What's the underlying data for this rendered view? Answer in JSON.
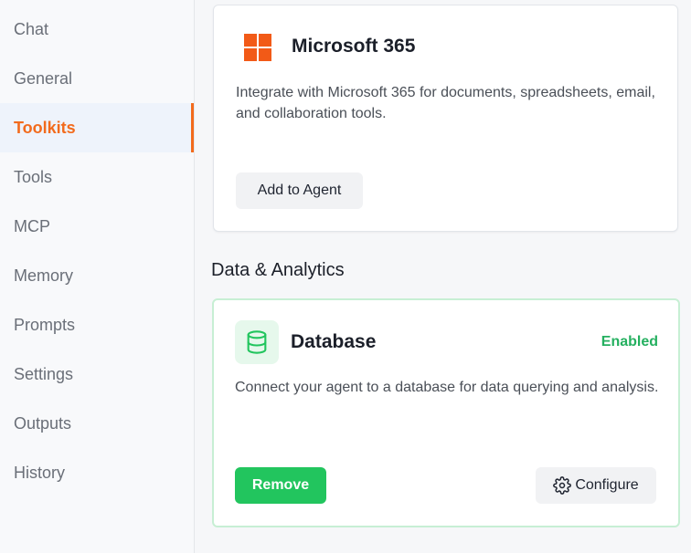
{
  "sidebar": {
    "items": [
      {
        "label": "Chat",
        "active": false
      },
      {
        "label": "General",
        "active": false
      },
      {
        "label": "Toolkits",
        "active": true
      },
      {
        "label": "Tools",
        "active": false
      },
      {
        "label": "MCP",
        "active": false
      },
      {
        "label": "Memory",
        "active": false
      },
      {
        "label": "Prompts",
        "active": false
      },
      {
        "label": "Settings",
        "active": false
      },
      {
        "label": "Outputs",
        "active": false
      },
      {
        "label": "History",
        "active": false
      }
    ]
  },
  "toolkits": {
    "microsoft": {
      "icon": "microsoft-logo-icon",
      "title": "Microsoft 365",
      "description": "Integrate with Microsoft 365 for documents, spreadsheets, email, and collaboration tools.",
      "button_label": "Add to Agent"
    },
    "section_title": "Data & Analytics",
    "database": {
      "icon": "database-icon",
      "title": "Database",
      "status": "Enabled",
      "description": "Connect your agent to a database for data querying and analysis.",
      "remove_label": "Remove",
      "configure_label": "Configure"
    }
  },
  "colors": {
    "accent": "#f26b1d",
    "enabled_green": "#22c55e",
    "microsoft_orange": "#f25a17"
  }
}
